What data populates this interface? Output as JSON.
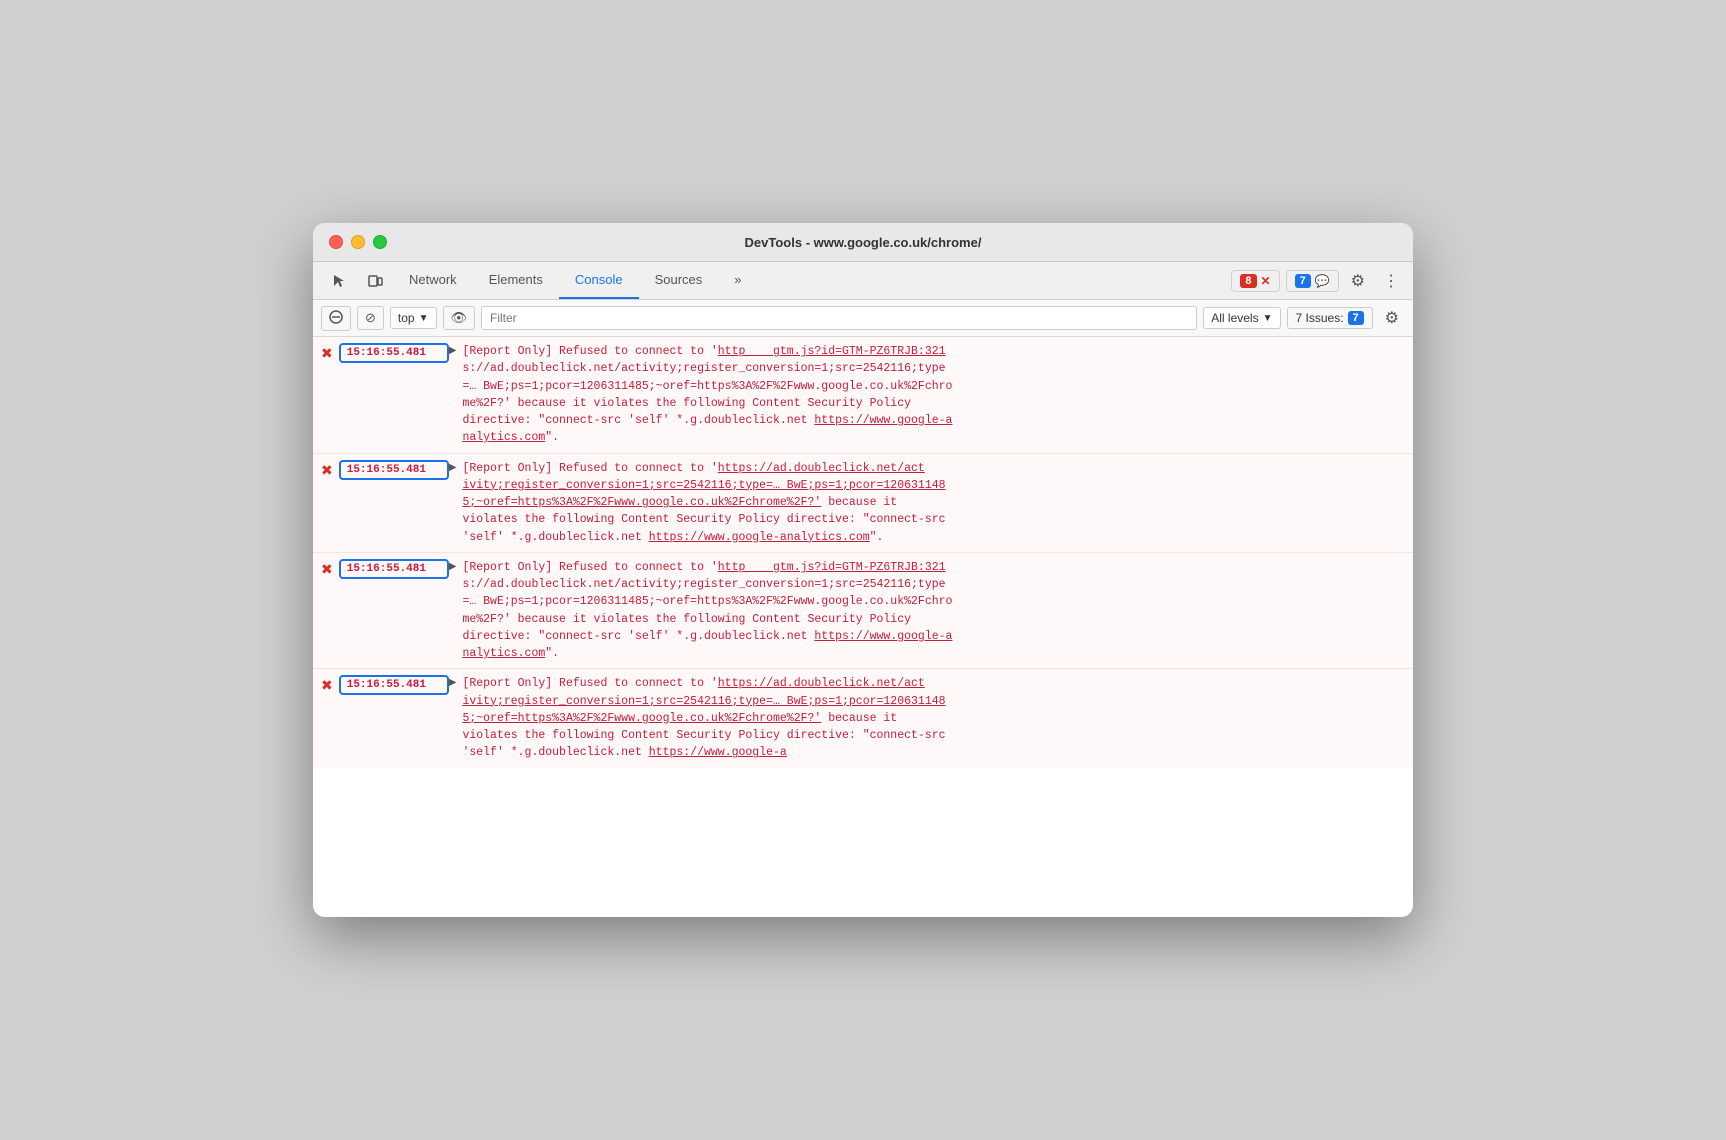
{
  "titlebar": {
    "title": "DevTools - www.google.co.uk/chrome/"
  },
  "toolbar": {
    "tabs": [
      {
        "id": "network",
        "label": "Network",
        "active": false
      },
      {
        "id": "elements",
        "label": "Elements",
        "active": false
      },
      {
        "id": "console",
        "label": "Console",
        "active": true
      },
      {
        "id": "sources",
        "label": "Sources",
        "active": false
      }
    ],
    "error_count": "8",
    "warning_count": "7",
    "more_label": "»"
  },
  "console_toolbar": {
    "top_label": "top",
    "filter_placeholder": "Filter",
    "levels_label": "All levels",
    "issues_label": "7 Issues:",
    "issues_count": "7"
  },
  "log_entries": [
    {
      "id": 1,
      "timestamp": "15:16:55.481",
      "highlighted": true,
      "source": "gtm.js?id=GTM-PZ6TRJB:321",
      "text": "[Report Only] Refused to connect to 'https://ad.doubleclick.net/activity;register_conversion=1;src=2542116;type=… BwE;ps=1;pcor=1206311485;~oref=https%3A%2F%2Fwww.google.co.uk%2Fchrome%2F?' because it violates the following Content Security Policy directive: \"connect-src 'self' *.g.doubleclick.net https://www.google-analytics.com\"."
    },
    {
      "id": 2,
      "timestamp": "15:16:55.481",
      "highlighted": true,
      "source": "",
      "text": "[Report Only] Refused to connect to 'https://ad.doubleclick.net/activity;register_conversion=1;src=2542116;type=… BwE;ps=1;pcor=1206311485;~oref=https%3A%2F%2Fwww.google.co.uk%2Fchrome%2F?' because it violates the following Content Security Policy directive: \"connect-src 'self' *.g.doubleclick.net https://www.google-analytics.com\"."
    },
    {
      "id": 3,
      "timestamp": "15:16:55.481",
      "highlighted": true,
      "source": "gtm.js?id=GTM-PZ6TRJB:321",
      "text": "[Report Only] Refused to connect to 'https://ad.doubleclick.net/activity;register_conversion=1;src=2542116;type=… BwE;ps=1;pcor=1206311485;~oref=https%3A%2F%2Fwww.google.co.uk%2Fchrome%2F?' because it violates the following Content Security Policy directive: \"connect-src 'self' *.g.doubleclick.net https://www.google-analytics.com\"."
    },
    {
      "id": 4,
      "timestamp": "15:16:55.481",
      "highlighted": true,
      "source": "",
      "text": "[Report Only] Refused to connect to 'https://ad.doubleclick.net/activity;register_conversion=1;src=2542116;type=… BwE;ps=1;pcor=1206311485;~oref=https%3A%2F%2Fwww.google.co.uk%2Fchrome%2F?' because it violates the following Content Security Policy directive: \"connect-src 'self' *.g.doubleclick.net https://www.google-analytics.com\""
    }
  ]
}
